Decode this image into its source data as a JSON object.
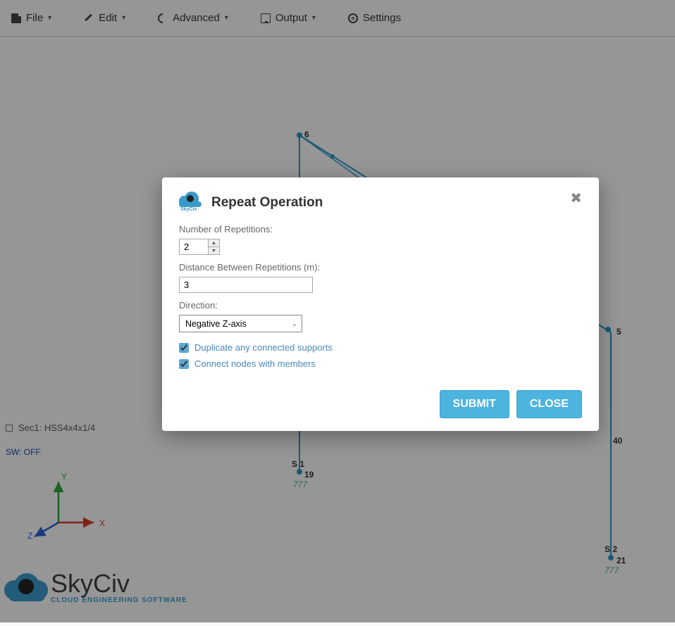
{
  "menubar": {
    "file": "File",
    "edit": "Edit",
    "advanced": "Advanced",
    "output": "Output",
    "settings": "Settings"
  },
  "canvas": {
    "nodes": {
      "n6": "6",
      "n5": "5",
      "n19": "19",
      "n21": "21",
      "n40": "40"
    },
    "supports": {
      "s1": "S 1",
      "s2": "S 2"
    }
  },
  "section_label": "Sec1: HSS4x4x1/4",
  "sw_label": "SW: OFF",
  "axis": {
    "x": "X",
    "y": "Y",
    "z": "Z"
  },
  "logo": {
    "name": "SkyCiv",
    "tag": "CLOUD ENGINEERING SOFTWARE",
    "small": "SkyCiv"
  },
  "modal": {
    "title": "Repeat Operation",
    "num_label": "Number of Repetitions:",
    "num_value": "2",
    "dist_label": "Distance Between Repetitions (m):",
    "dist_value": "3",
    "dir_label": "Direction:",
    "dir_value": "Negative Z-axis",
    "check1": "Duplicate any connected supports",
    "check2": "Connect nodes with members",
    "submit": "SUBMIT",
    "close": "CLOSE"
  }
}
